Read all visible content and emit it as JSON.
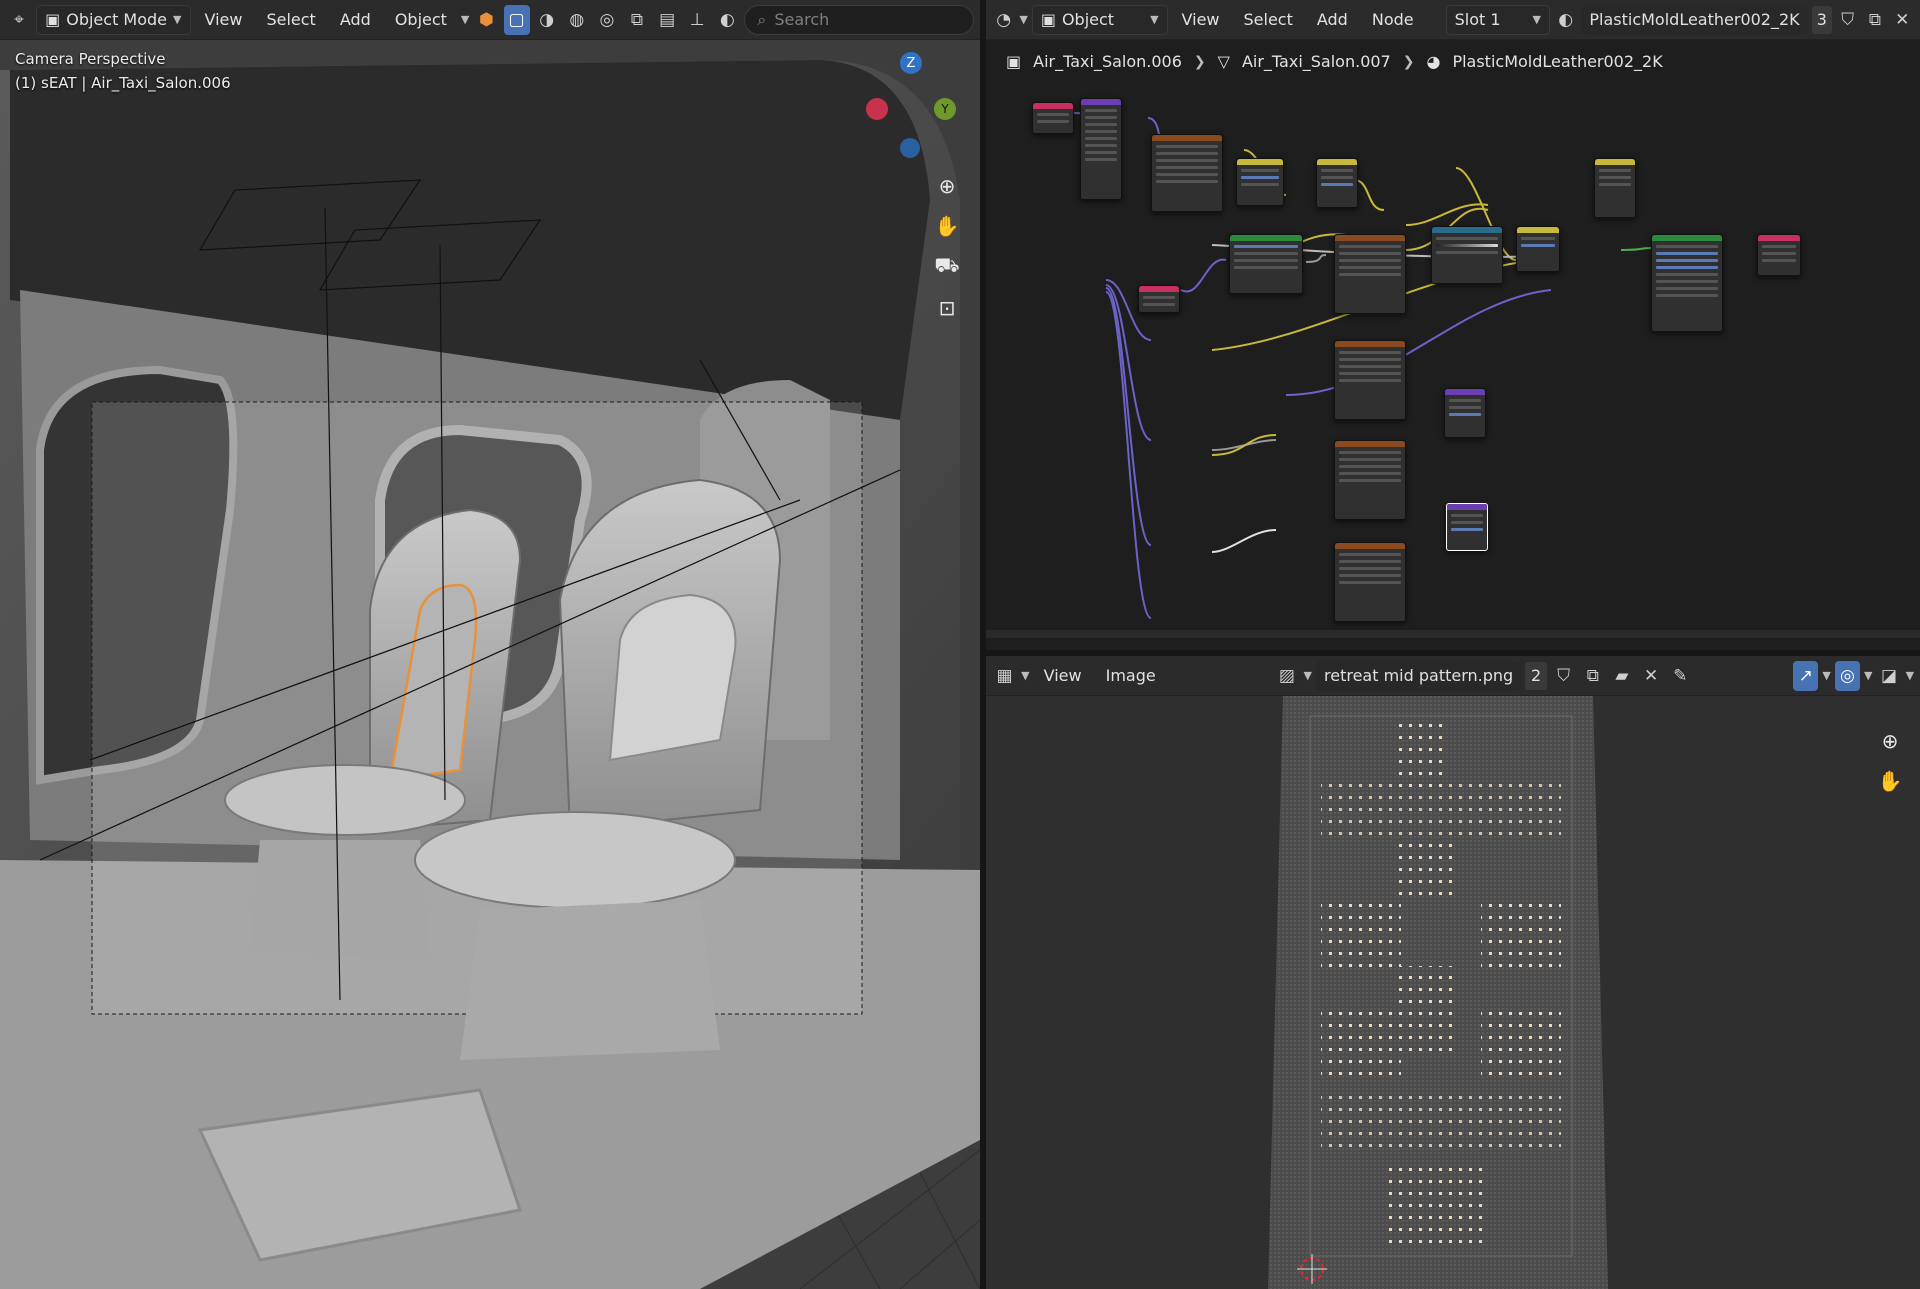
{
  "viewport": {
    "header": {
      "mode_label": "Object Mode",
      "menus": [
        "View",
        "Select",
        "Add",
        "Object"
      ],
      "search_placeholder": "Search"
    },
    "overlay": {
      "line1": "Camera Perspective",
      "line2": "(1) sEAT | Air_Taxi_Salon.006"
    },
    "gizmo": {
      "z_label": "Z",
      "y_label": "Y"
    }
  },
  "node_editor": {
    "header": {
      "type_label": "Object",
      "menus": [
        "View",
        "Select",
        "Add",
        "Node"
      ],
      "slot_label": "Slot 1",
      "material_name": "PlasticMoldLeather002_2K",
      "user_count": "3"
    },
    "breadcrumb": {
      "object": "Air_Taxi_Salon.006",
      "mesh": "Air_Taxi_Salon.007",
      "material": "PlasticMoldLeather002_2K"
    }
  },
  "image_editor": {
    "header": {
      "menus": [
        "View",
        "Image"
      ],
      "image_name": "retreat mid pattern.png",
      "user_count": "2"
    }
  },
  "colors": {
    "accent_blue": "#4772b3",
    "selection_orange": "#e8913a",
    "node_tex": "#8a4a1f",
    "node_uv": "#c8305f",
    "node_vec": "#6b3fb3",
    "node_shader": "#2b8a3e",
    "node_color": "#c8b93a",
    "node_ramp": "#2a6a8a"
  }
}
